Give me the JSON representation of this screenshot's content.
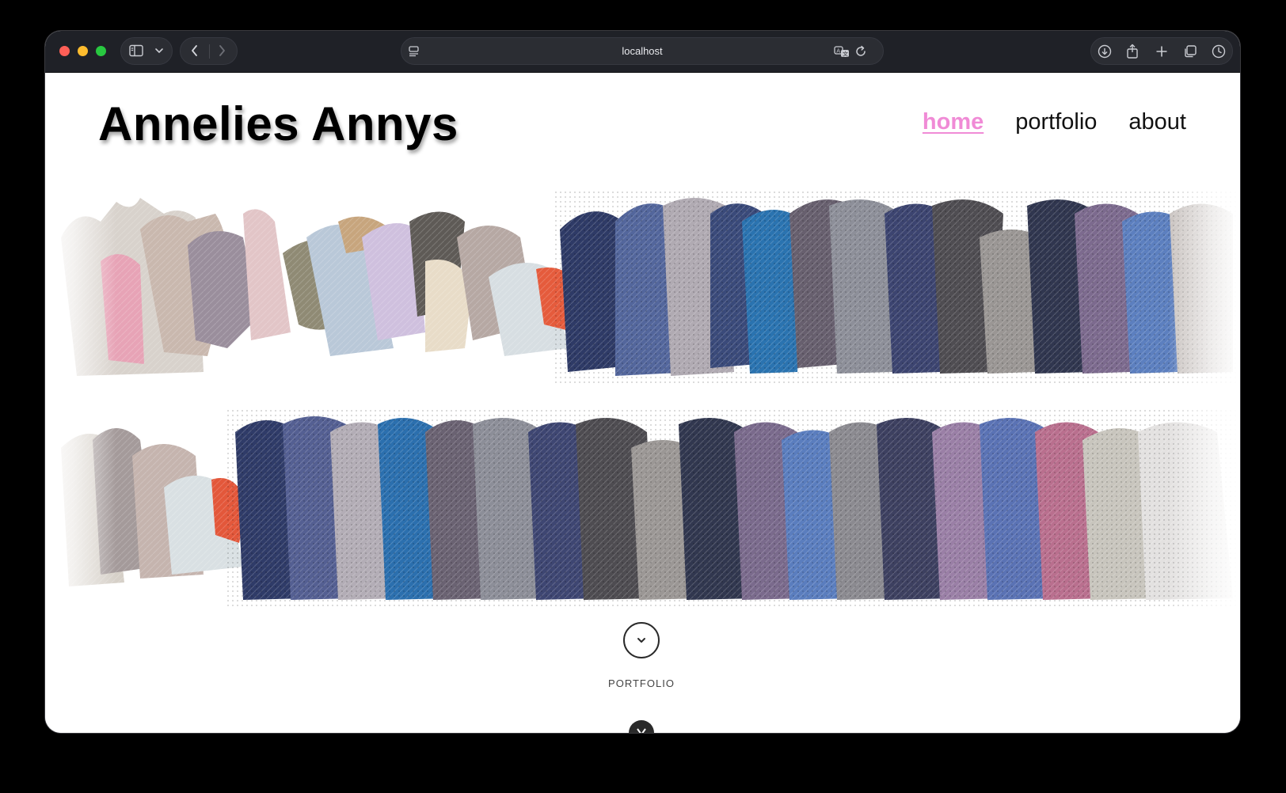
{
  "browser": {
    "url": "localhost",
    "icons": {
      "sidebar": "sidebar-icon",
      "chevron_down": "chevron-down-icon",
      "back": "back-icon",
      "forward": "forward-icon",
      "page_menu": "page-menu-icon",
      "translate": "translate-icon",
      "reload": "reload-icon",
      "download": "download-icon",
      "share": "share-icon",
      "new_tab": "plus-icon",
      "tab_overview": "tabs-icon",
      "history": "clock-icon"
    }
  },
  "site": {
    "title": "Annelies Annys",
    "nav": [
      {
        "label": "home",
        "active": true
      },
      {
        "label": "portfolio",
        "active": false
      },
      {
        "label": "about",
        "active": false
      }
    ],
    "accent_color": "#f08bd6"
  },
  "scroll_hint": {
    "label": "PORTFOLIO",
    "icon": "chevron-down-icon"
  }
}
